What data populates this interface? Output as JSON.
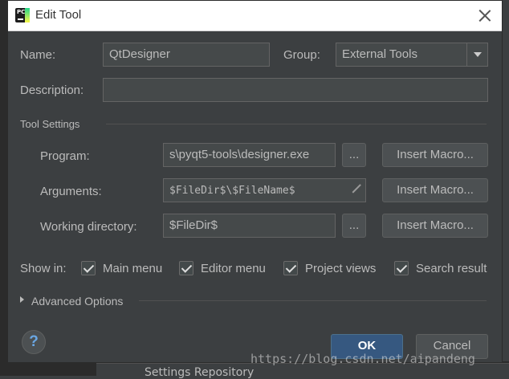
{
  "window": {
    "title": "Edit Tool",
    "app_icon": "pycharm-icon"
  },
  "form": {
    "name_label": "Name:",
    "name_value": "QtDesigner",
    "group_label": "Group:",
    "group_value": "External Tools",
    "description_label": "Description:",
    "description_value": ""
  },
  "tool_settings": {
    "title": "Tool Settings",
    "program_label": "Program:",
    "program_value": "s\\pyqt5-tools\\designer.exe",
    "arguments_label": "Arguments:",
    "arguments_value": "$FileDir$\\$FileName$",
    "working_dir_label": "Working directory:",
    "working_dir_value": "$FileDir$",
    "browse_label": "...",
    "insert_macro_label": "Insert Macro..."
  },
  "show_in": {
    "label": "Show in:",
    "options": [
      {
        "label": "Main menu",
        "checked": true
      },
      {
        "label": "Editor menu",
        "checked": true
      },
      {
        "label": "Project views",
        "checked": true
      },
      {
        "label": "Search result",
        "checked": true
      }
    ]
  },
  "advanced": {
    "label": "Advanced Options"
  },
  "buttons": {
    "ok": "OK",
    "cancel": "Cancel",
    "help": "?"
  },
  "watermark": "https://blog.csdn.net/aipandeng",
  "background": {
    "panel_text": "Settings Repository"
  }
}
